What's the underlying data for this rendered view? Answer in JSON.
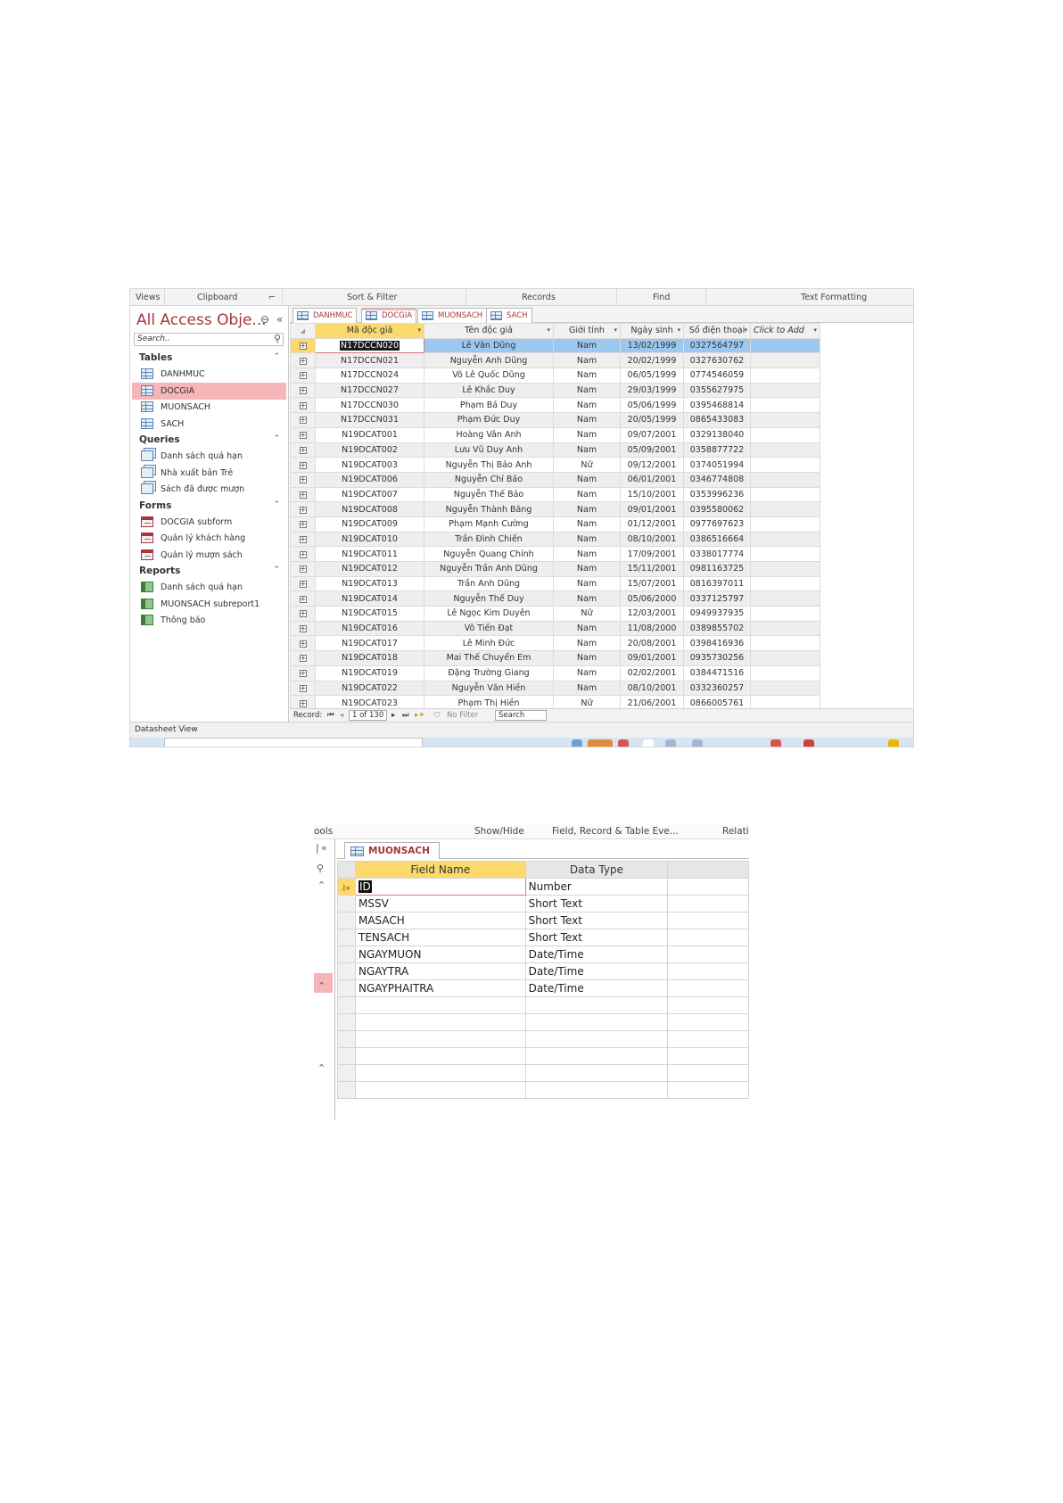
{
  "screen1": {
    "ribbon": [
      "Views",
      "Clipboard",
      "Sort & Filter",
      "Records",
      "Find",
      "Text Formatting"
    ],
    "nav": {
      "title": "All Access Obje...",
      "search_placeholder": "Search..",
      "groups": [
        {
          "name": "Tables",
          "items": [
            "DANHMUC",
            "DOCGIA",
            "MUONSACH",
            "SACH"
          ],
          "type": "table"
        },
        {
          "name": "Queries",
          "items": [
            "Danh sách quá hạn",
            "Nhà xuất bản Trẻ",
            "Sách đã được mượn"
          ],
          "type": "query"
        },
        {
          "name": "Forms",
          "items": [
            "DOCGIA subform",
            "Quản lý khách hàng",
            "Quản lý mượn sách"
          ],
          "type": "form"
        },
        {
          "name": "Reports",
          "items": [
            "Danh sách quá hạn",
            "MUONSACH subreport1",
            "Thông báo"
          ],
          "type": "report"
        }
      ]
    },
    "tabs": [
      "DANHMUC",
      "DOCGIA",
      "MUONSACH",
      "SACH"
    ],
    "active_tab": 1,
    "columns": [
      "Mã độc giả",
      "Tên độc giả",
      "Giới tính",
      "Ngày sinh",
      "Số điện thoại",
      "Click to Add"
    ],
    "rows": [
      [
        "N17DCCN020",
        "Lê Văn Dũng",
        "Nam",
        "13/02/1999",
        "0327564797"
      ],
      [
        "N17DCCN021",
        "Nguyễn Anh Dũng",
        "Nam",
        "20/02/1999",
        "0327630762"
      ],
      [
        "N17DCCN024",
        "Võ Lê Quốc Dũng",
        "Nam",
        "06/05/1999",
        "0774546059"
      ],
      [
        "N17DCCN027",
        "Lê Khắc Duy",
        "Nam",
        "29/03/1999",
        "0355627975"
      ],
      [
        "N17DCCN030",
        "Phạm Bá Duy",
        "Nam",
        "05/06/1999",
        "0395468814"
      ],
      [
        "N17DCCN031",
        "Phạm Đức Duy",
        "Nam",
        "20/05/1999",
        "0865433083"
      ],
      [
        "N19DCAT001",
        "Hoàng Vân Anh",
        "Nam",
        "09/07/2001",
        "0329138040"
      ],
      [
        "N19DCAT002",
        "Lưu Vũ Duy Anh",
        "Nam",
        "05/09/2001",
        "0358877722"
      ],
      [
        "N19DCAT003",
        "Nguyễn Thị Bảo Anh",
        "Nữ",
        "09/12/2001",
        "0374051994"
      ],
      [
        "N19DCAT006",
        "Nguyễn Chí Bảo",
        "Nam",
        "06/01/2001",
        "0346774808"
      ],
      [
        "N19DCAT007",
        "Nguyễn Thế Bảo",
        "Nam",
        "15/10/2001",
        "0353996236"
      ],
      [
        "N19DCAT008",
        "Nguyễn Thành Băng",
        "Nam",
        "09/01/2001",
        "0395580062"
      ],
      [
        "N19DCAT009",
        "Phạm Mạnh Cường",
        "Nam",
        "01/12/2001",
        "0977697623"
      ],
      [
        "N19DCAT010",
        "Trần Đình Chiến",
        "Nam",
        "08/10/2001",
        "0386516664"
      ],
      [
        "N19DCAT011",
        "Nguyễn Quang Chính",
        "Nam",
        "17/09/2001",
        "0338017774"
      ],
      [
        "N19DCAT012",
        "Nguyễn Trần Anh Dũng",
        "Nam",
        "15/11/2001",
        "0981163725"
      ],
      [
        "N19DCAT013",
        "Trần Anh Dũng",
        "Nam",
        "15/07/2001",
        "0816397011"
      ],
      [
        "N19DCAT014",
        "Nguyễn Thế Duy",
        "Nam",
        "05/06/2000",
        "0337125797"
      ],
      [
        "N19DCAT015",
        "Lê Ngọc Kim Duyên",
        "Nữ",
        "12/03/2001",
        "0949937935"
      ],
      [
        "N19DCAT016",
        "Võ Tiến Đạt",
        "Nam",
        "11/08/2000",
        "0389855702"
      ],
      [
        "N19DCAT017",
        "Lê Minh Đức",
        "Nam",
        "20/08/2001",
        "0398416936"
      ],
      [
        "N19DCAT018",
        "Mai Thế Chuyển Em",
        "Nam",
        "09/01/2001",
        "0935730256"
      ],
      [
        "N19DCAT019",
        "Đặng Trường Giang",
        "Nam",
        "02/02/2001",
        "0384471516"
      ],
      [
        "N19DCAT022",
        "Nguyễn Văn Hiền",
        "Nam",
        "08/10/2001",
        "0332360257"
      ],
      [
        "N19DCAT023",
        "Phạm Thị Hiền",
        "Nữ",
        "21/06/2001",
        "0866005761"
      ]
    ],
    "record_nav": {
      "label": "Record:",
      "position": "1 of 130",
      "filter": "No Filter",
      "search": "Search"
    },
    "status": "Datasheet View"
  },
  "screen2": {
    "ribbon": [
      "ools",
      "Show/Hide",
      "Field, Record & Table Eve...",
      "Relati"
    ],
    "nav_collapse": "«",
    "tab": "MUONSACH",
    "columns": [
      "Field Name",
      "Data Type"
    ],
    "fields": [
      [
        "ID",
        "Number"
      ],
      [
        "MSSV",
        "Short Text"
      ],
      [
        "MASACH",
        "Short Text"
      ],
      [
        "TENSACH",
        "Short Text"
      ],
      [
        "NGAYMUON",
        "Date/Time"
      ],
      [
        "NGAYTRA",
        "Date/Time"
      ],
      [
        "NGAYPHAITRA",
        "Date/Time"
      ]
    ],
    "empty_rows": 6
  },
  "colors": {
    "accent": "#a4373a",
    "selected_nav": "#f4b6b7",
    "sorted_header": "#fbd96d",
    "current_row": "#9cc7ee"
  }
}
